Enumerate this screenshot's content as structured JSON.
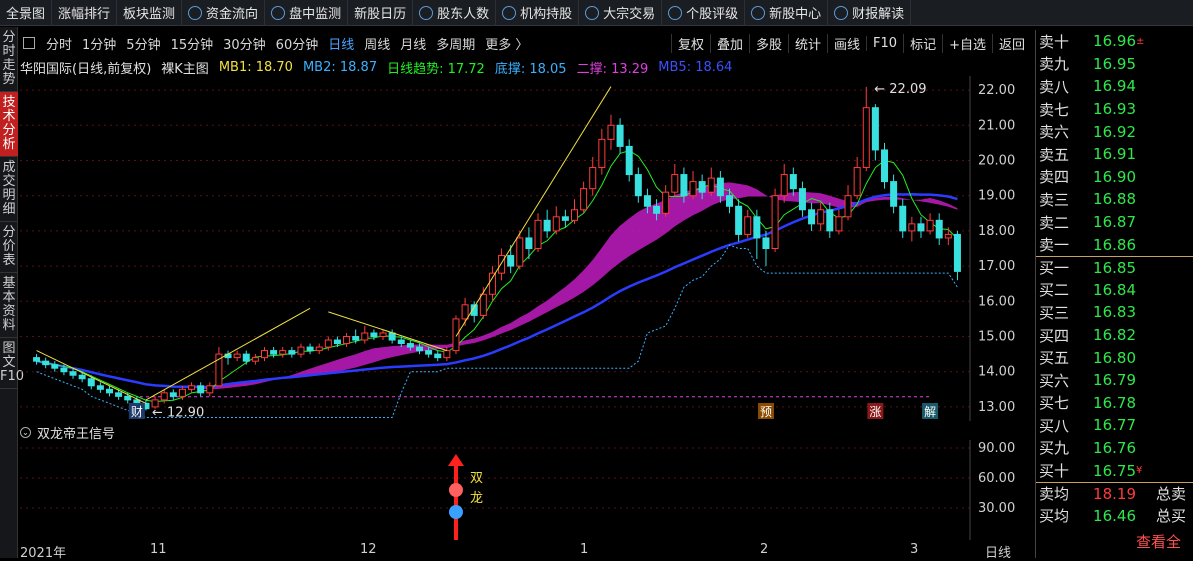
{
  "top_menu": [
    {
      "label": "全景图"
    },
    {
      "label": "涨幅排行"
    },
    {
      "label": "板块监测"
    },
    {
      "label": "资金流向",
      "icon": "flow-icon"
    },
    {
      "label": "盘中监测",
      "icon": "monitor-icon"
    },
    {
      "label": "新股日历"
    },
    {
      "label": "股东人数",
      "icon": "shareholder-icon"
    },
    {
      "label": "机构持股",
      "icon": "institution-icon"
    },
    {
      "label": "大宗交易",
      "icon": "block-trade-icon"
    },
    {
      "label": "个股评级",
      "icon": "rating-icon"
    },
    {
      "label": "新股中心",
      "icon": "ipo-icon"
    },
    {
      "label": "财报解读",
      "icon": "report-icon"
    }
  ],
  "side_tabs": [
    {
      "label": "分时走势"
    },
    {
      "label": "技术分析",
      "active": true
    },
    {
      "label": "成交明细"
    },
    {
      "label": "分价表"
    },
    {
      "label": "基本资料"
    },
    {
      "label": "图文F10"
    }
  ],
  "periods": [
    {
      "label": "分时"
    },
    {
      "label": "1分钟"
    },
    {
      "label": "5分钟"
    },
    {
      "label": "15分钟"
    },
    {
      "label": "30分钟"
    },
    {
      "label": "60分钟"
    },
    {
      "label": "日线",
      "active": true
    },
    {
      "label": "周线"
    },
    {
      "label": "月线"
    },
    {
      "label": "多周期"
    },
    {
      "label": "更多 〉"
    }
  ],
  "tools": [
    "复权",
    "叠加",
    "多股",
    "统计",
    "画线",
    "F10",
    "标记",
    "+自选",
    "返回"
  ],
  "legend": {
    "stock": "华阳国际(日线,前复权)",
    "main": "裸K主图",
    "mb1": "MB1: 18.70",
    "mb2": "MB2: 18.87",
    "trend": "日线趋势: 17.72",
    "bottom": "底撑: 18.05",
    "second": "二撑: 13.29",
    "mb5": "MB5: 18.64"
  },
  "colors": {
    "up": "#ff3b3b",
    "down": "#38e0e0",
    "mb1": "#f0e040",
    "mb2": "#3ab0ff",
    "trend": "#22ee22",
    "bottom": "#3ab0ff",
    "second": "#e040e0",
    "mb5": "#2b3cff",
    "grid": "#8b1a1a"
  },
  "price_axis": [
    "22.00",
    "21.00",
    "20.00",
    "19.00",
    "18.00",
    "17.00",
    "16.00",
    "15.00",
    "14.00",
    "13.00"
  ],
  "annotations": {
    "high": "22.09",
    "low": "12.90",
    "event_cai": "财",
    "event_yu": "预",
    "event_zhang": "涨",
    "event_jie": "解"
  },
  "sub_chart": {
    "title": "双龙帝王信号",
    "axis": [
      "90.00",
      "60.00",
      "30.00"
    ],
    "signal_char1": "双",
    "signal_char2": "龙"
  },
  "date_axis": [
    "2021年",
    "11",
    "12",
    "1",
    "2",
    "3"
  ],
  "axis_period": "日线",
  "order_book": {
    "asks": [
      {
        "label": "卖十",
        "price": "16.96",
        "flag": "±"
      },
      {
        "label": "卖九",
        "price": "16.95"
      },
      {
        "label": "卖八",
        "price": "16.94"
      },
      {
        "label": "卖七",
        "price": "16.93"
      },
      {
        "label": "卖六",
        "price": "16.92"
      },
      {
        "label": "卖五",
        "price": "16.91"
      },
      {
        "label": "卖四",
        "price": "16.90"
      },
      {
        "label": "卖三",
        "price": "16.88"
      },
      {
        "label": "卖二",
        "price": "16.87"
      },
      {
        "label": "卖一",
        "price": "16.86"
      }
    ],
    "bids": [
      {
        "label": "买一",
        "price": "16.85"
      },
      {
        "label": "买二",
        "price": "16.84"
      },
      {
        "label": "买三",
        "price": "16.83"
      },
      {
        "label": "买四",
        "price": "16.82"
      },
      {
        "label": "买五",
        "price": "16.80"
      },
      {
        "label": "买六",
        "price": "16.79"
      },
      {
        "label": "买七",
        "price": "16.78"
      },
      {
        "label": "买八",
        "price": "16.77"
      },
      {
        "label": "买九",
        "price": "16.76"
      },
      {
        "label": "买十",
        "price": "16.75",
        "flag": "¥"
      }
    ],
    "avg": [
      {
        "label": "卖均",
        "price": "18.19",
        "color": "#ff3b3b",
        "extra": "总卖"
      },
      {
        "label": "买均",
        "price": "16.46",
        "color": "#2ee84b",
        "extra": "总买"
      }
    ],
    "view_all": "查看全"
  },
  "chart_data": {
    "type": "candlestick",
    "title": "华阳国际(日线,前复权)",
    "ylim": [
      12.6,
      22.4
    ],
    "dates_start": "2021年10月",
    "candles": [
      [
        14.4,
        14.3,
        14.5,
        14.2
      ],
      [
        14.3,
        14.2,
        14.4,
        14.1
      ],
      [
        14.2,
        14.1,
        14.3,
        14.0
      ],
      [
        14.1,
        14.0,
        14.2,
        13.9
      ],
      [
        14.0,
        13.9,
        14.1,
        13.8
      ],
      [
        13.9,
        13.8,
        14.0,
        13.7
      ],
      [
        13.8,
        13.6,
        13.9,
        13.5
      ],
      [
        13.6,
        13.5,
        13.7,
        13.4
      ],
      [
        13.5,
        13.4,
        13.6,
        13.3
      ],
      [
        13.4,
        13.3,
        13.5,
        13.2
      ],
      [
        13.3,
        13.2,
        13.4,
        13.1
      ],
      [
        13.2,
        13.1,
        13.3,
        13.0
      ],
      [
        13.1,
        12.95,
        13.2,
        12.9
      ],
      [
        13.0,
        13.2,
        13.3,
        12.95
      ],
      [
        13.2,
        13.4,
        13.5,
        13.1
      ],
      [
        13.4,
        13.3,
        13.5,
        13.2
      ],
      [
        13.3,
        13.5,
        13.6,
        13.2
      ],
      [
        13.5,
        13.6,
        13.7,
        13.4
      ],
      [
        13.6,
        13.4,
        13.7,
        13.3
      ],
      [
        13.4,
        13.6,
        13.7,
        13.3
      ],
      [
        13.6,
        14.5,
        14.7,
        13.6
      ],
      [
        14.5,
        14.4,
        14.6,
        14.2
      ],
      [
        14.4,
        14.5,
        14.6,
        14.3
      ],
      [
        14.5,
        14.3,
        14.6,
        14.2
      ],
      [
        14.3,
        14.4,
        14.5,
        14.2
      ],
      [
        14.4,
        14.6,
        14.7,
        14.3
      ],
      [
        14.6,
        14.5,
        14.7,
        14.4
      ],
      [
        14.5,
        14.6,
        14.7,
        14.4
      ],
      [
        14.6,
        14.5,
        14.7,
        14.4
      ],
      [
        14.5,
        14.7,
        14.8,
        14.4
      ],
      [
        14.7,
        14.6,
        14.8,
        14.5
      ],
      [
        14.6,
        14.7,
        14.8,
        14.5
      ],
      [
        14.7,
        14.9,
        15.0,
        14.6
      ],
      [
        14.9,
        14.8,
        15.0,
        14.7
      ],
      [
        14.8,
        15.0,
        15.1,
        14.7
      ],
      [
        15.0,
        14.9,
        15.2,
        14.8
      ],
      [
        14.9,
        15.1,
        15.3,
        14.8
      ],
      [
        15.1,
        15.0,
        15.2,
        14.9
      ],
      [
        15.0,
        15.1,
        15.2,
        14.9
      ],
      [
        15.1,
        14.9,
        15.2,
        14.8
      ],
      [
        14.9,
        14.8,
        15.0,
        14.7
      ],
      [
        14.8,
        14.7,
        14.9,
        14.6
      ],
      [
        14.7,
        14.6,
        14.8,
        14.5
      ],
      [
        14.6,
        14.5,
        14.7,
        14.4
      ],
      [
        14.5,
        14.4,
        14.6,
        14.3
      ],
      [
        14.4,
        14.6,
        14.7,
        14.3
      ],
      [
        14.6,
        15.5,
        15.6,
        14.5
      ],
      [
        15.5,
        15.9,
        16.1,
        15.3
      ],
      [
        15.9,
        15.6,
        16.0,
        15.4
      ],
      [
        15.6,
        16.2,
        16.4,
        15.5
      ],
      [
        16.2,
        16.8,
        17.0,
        16.0
      ],
      [
        16.8,
        17.3,
        17.5,
        16.6
      ],
      [
        17.3,
        17.0,
        17.6,
        16.8
      ],
      [
        17.0,
        17.8,
        18.0,
        16.9
      ],
      [
        17.8,
        17.5,
        18.1,
        17.2
      ],
      [
        17.5,
        18.3,
        18.5,
        17.4
      ],
      [
        18.3,
        18.0,
        18.6,
        17.8
      ],
      [
        18.0,
        18.4,
        18.7,
        17.9
      ],
      [
        18.4,
        18.3,
        18.6,
        18.1
      ],
      [
        18.3,
        18.6,
        18.9,
        18.2
      ],
      [
        18.6,
        19.2,
        19.4,
        18.5
      ],
      [
        19.2,
        19.8,
        20.1,
        19.0
      ],
      [
        19.8,
        20.6,
        20.9,
        19.6
      ],
      [
        20.6,
        21.0,
        21.3,
        20.3
      ],
      [
        21.0,
        20.4,
        21.2,
        20.2
      ],
      [
        20.4,
        19.6,
        20.6,
        19.4
      ],
      [
        19.6,
        19.0,
        19.8,
        18.8
      ],
      [
        19.0,
        18.7,
        19.2,
        18.5
      ],
      [
        18.7,
        18.5,
        18.9,
        18.3
      ],
      [
        18.5,
        19.1,
        19.3,
        18.4
      ],
      [
        19.1,
        19.6,
        19.9,
        19.0
      ],
      [
        19.6,
        19.0,
        19.8,
        18.8
      ],
      [
        19.0,
        19.4,
        19.7,
        18.9
      ],
      [
        19.4,
        19.1,
        19.6,
        18.9
      ],
      [
        19.1,
        19.5,
        19.8,
        19.0
      ],
      [
        19.5,
        19.0,
        19.7,
        18.8
      ],
      [
        19.0,
        18.7,
        19.2,
        18.5
      ],
      [
        18.7,
        17.9,
        18.9,
        17.7
      ],
      [
        17.9,
        18.4,
        18.6,
        17.8
      ],
      [
        18.4,
        17.8,
        18.6,
        17.2
      ],
      [
        17.8,
        17.5,
        18.0,
        17.0
      ],
      [
        17.5,
        19.0,
        19.2,
        17.4
      ],
      [
        19.0,
        19.6,
        19.9,
        18.8
      ],
      [
        19.6,
        19.2,
        19.8,
        19.0
      ],
      [
        19.2,
        18.6,
        19.4,
        18.4
      ],
      [
        18.6,
        18.2,
        18.8,
        18.0
      ],
      [
        18.2,
        18.6,
        18.8,
        18.0
      ],
      [
        18.6,
        18.0,
        18.8,
        17.8
      ],
      [
        18.0,
        18.4,
        18.6,
        17.9
      ],
      [
        18.4,
        19.0,
        19.3,
        18.3
      ],
      [
        19.0,
        19.8,
        20.1,
        18.9
      ],
      [
        19.8,
        21.5,
        22.09,
        19.7
      ],
      [
        21.5,
        20.3,
        21.6,
        20.0
      ],
      [
        20.3,
        19.4,
        20.5,
        19.2
      ],
      [
        19.4,
        18.7,
        19.6,
        18.5
      ],
      [
        18.7,
        18.0,
        18.9,
        17.8
      ],
      [
        18.0,
        18.2,
        18.4,
        17.7
      ],
      [
        18.2,
        18.0,
        18.4,
        17.8
      ],
      [
        18.0,
        18.3,
        18.5,
        17.9
      ],
      [
        18.3,
        17.8,
        18.5,
        17.6
      ],
      [
        17.8,
        17.9,
        18.1,
        17.6
      ],
      [
        17.9,
        16.85,
        18.0,
        16.6
      ]
    ],
    "series": [
      {
        "name": "MB1",
        "last": 18.7
      },
      {
        "name": "MB2",
        "last": 18.87
      },
      {
        "name": "日线趋势",
        "last": 17.72
      },
      {
        "name": "底撑",
        "last": 18.05
      },
      {
        "name": "二撑",
        "last": 13.29
      },
      {
        "name": "MB5",
        "last": 18.64
      }
    ]
  }
}
